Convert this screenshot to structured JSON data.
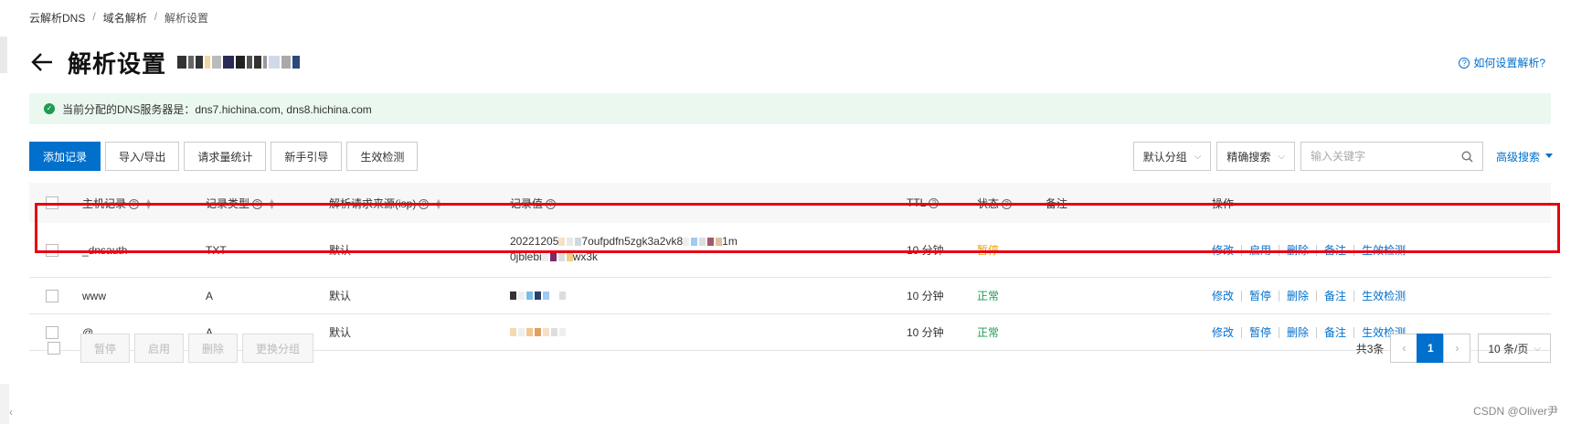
{
  "breadcrumb": {
    "items": [
      "云解析DNS",
      "域名解析",
      "解析设置"
    ],
    "sep": "/"
  },
  "title": {
    "text": "解析设置"
  },
  "help": {
    "label": "如何设置解析?"
  },
  "notice": {
    "text": "当前分配的DNS服务器是：dns7.hichina.com, dns8.hichina.com"
  },
  "toolbar": {
    "buttons": [
      "添加记录",
      "导入/导出",
      "请求量统计",
      "新手引导",
      "生效检测"
    ]
  },
  "filters": {
    "group_select": "默认分组",
    "search_type": "精确搜索",
    "search_placeholder": "输入关键字",
    "advanced": "高级搜索"
  },
  "table": {
    "headers": [
      "主机记录",
      "记录类型",
      "解析请求来源(isp)",
      "记录值",
      "TTL",
      "状态",
      "备注",
      "操作"
    ],
    "rows": [
      {
        "host": "_dnsauth",
        "type": "TXT",
        "isp": "默认",
        "value_line1_a": "20221205",
        "value_line1_b": "7oufpdfn5zgk3a2vk8",
        "value_line1_c": "1m",
        "value_line2_a": "0jblebi",
        "value_line2_b": "wx3k",
        "ttl": "10 分钟",
        "status": "暂停",
        "actions": [
          "修改",
          "启用",
          "删除",
          "备注",
          "生效检测"
        ]
      },
      {
        "host": "www",
        "type": "A",
        "isp": "默认",
        "ttl": "10 分钟",
        "status": "正常",
        "actions": [
          "修改",
          "暂停",
          "删除",
          "备注",
          "生效检测"
        ]
      },
      {
        "host": "@",
        "type": "A",
        "isp": "默认",
        "ttl": "10 分钟",
        "status": "正常",
        "actions": [
          "修改",
          "暂停",
          "删除",
          "备注",
          "生效检测"
        ]
      }
    ]
  },
  "batch": {
    "buttons": [
      "暂停",
      "启用",
      "删除",
      "更换分组"
    ]
  },
  "pagination": {
    "total": "共3条",
    "current": "1",
    "page_size": "10 条/页"
  },
  "watermark": "CSDN @Oliver尹",
  "colors": {
    "primary": "#0070cc",
    "paused": "#f0a000",
    "normal": "#1e9c4f",
    "highlight": "#e60012"
  }
}
